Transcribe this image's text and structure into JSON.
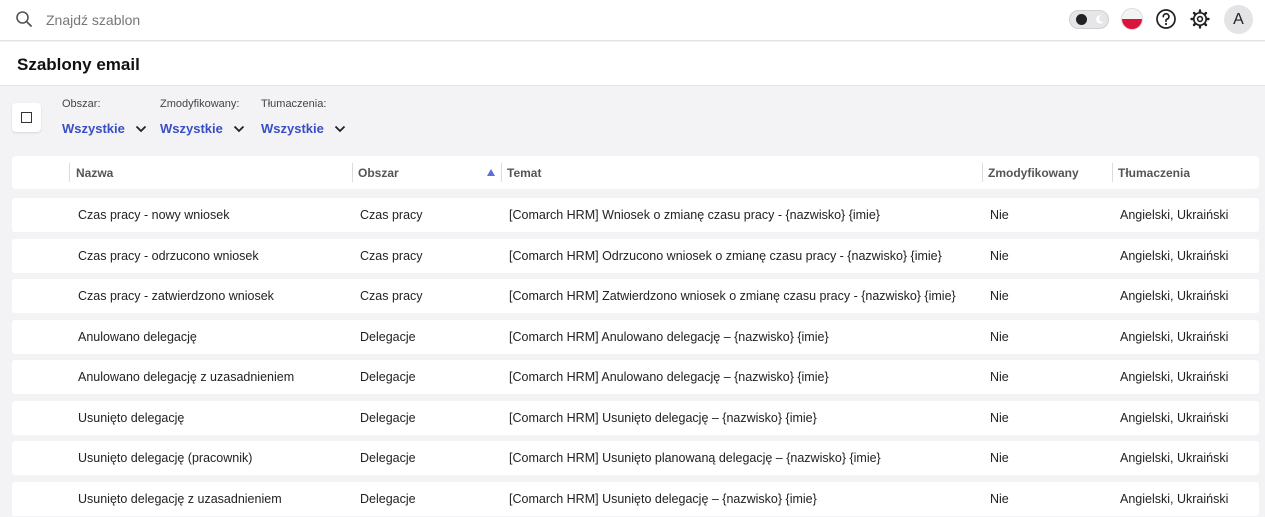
{
  "search": {
    "placeholder": "Znajdź szablon",
    "value": ""
  },
  "topbar": {
    "avatar_letter": "A",
    "language_flag": "flag-pl-icon"
  },
  "page": {
    "title": "Szablony email"
  },
  "filters": [
    {
      "label": "Obszar:",
      "value": "Wszystkie"
    },
    {
      "label": "Zmodyfikowany:",
      "value": "Wszystkie"
    },
    {
      "label": "Tłumaczenia:",
      "value": "Wszystkie"
    }
  ],
  "colors": {
    "accent": "#3a4fc6"
  },
  "table": {
    "columns": [
      "Nazwa",
      "Obszar",
      "Temat",
      "Zmodyfikowany",
      "Tłumaczenia"
    ],
    "sorted_column": "Obszar",
    "rows": [
      [
        "Czas pracy - nowy wniosek",
        "Czas pracy",
        "[Comarch HRM] Wniosek o zmianę czasu pracy - {nazwisko} {imie}",
        "Nie",
        "Angielski, Ukraiński"
      ],
      [
        "Czas pracy - odrzucono wniosek",
        "Czas pracy",
        "[Comarch HRM] Odrzucono wniosek o zmianę czasu pracy - {nazwisko} {imie}",
        "Nie",
        "Angielski, Ukraiński"
      ],
      [
        "Czas pracy - zatwierdzono wniosek",
        "Czas pracy",
        "[Comarch HRM] Zatwierdzono wniosek o zmianę czasu pracy - {nazwisko} {imie}",
        "Nie",
        "Angielski, Ukraiński"
      ],
      [
        "Anulowano delegację",
        "Delegacje",
        "[Comarch HRM] Anulowano delegację – {nazwisko} {imie}",
        "Nie",
        "Angielski, Ukraiński"
      ],
      [
        "Anulowano delegację z uzasadnieniem",
        "Delegacje",
        "[Comarch HRM] Anulowano delegację – {nazwisko} {imie}",
        "Nie",
        "Angielski, Ukraiński"
      ],
      [
        "Usunięto delegację",
        "Delegacje",
        "[Comarch HRM] Usunięto delegację – {nazwisko} {imie}",
        "Nie",
        "Angielski, Ukraiński"
      ],
      [
        "Usunięto delegację (pracownik)",
        "Delegacje",
        "[Comarch HRM] Usunięto planowaną delegację – {nazwisko} {imie}",
        "Nie",
        "Angielski, Ukraiński"
      ],
      [
        "Usunięto delegację z uzasadnieniem",
        "Delegacje",
        "[Comarch HRM] Usunięto delegację – {nazwisko} {imie}",
        "Nie",
        "Angielski, Ukraiński"
      ]
    ]
  }
}
